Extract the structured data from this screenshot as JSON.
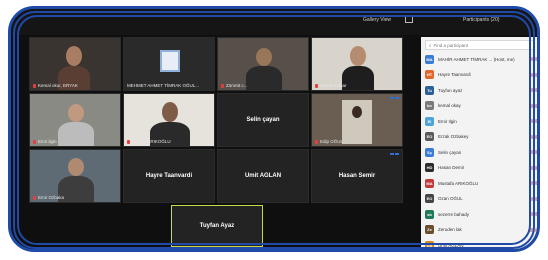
{
  "window": {
    "view_label": "Gallery View",
    "meeting_title": "Participants (20)"
  },
  "tiles": [
    {
      "name": "Kemal okur, ERYAK",
      "type": "video"
    },
    {
      "name": "MEHMET AHMET TİMRAK OĞUL...",
      "type": "logo"
    },
    {
      "name": "Zümrüt c...",
      "type": "video"
    },
    {
      "name": "sepere bahar",
      "type": "video"
    },
    {
      "name": "Emir ilgin",
      "type": "video"
    },
    {
      "name": "SATAN ARIKOĞLU",
      "type": "video"
    },
    {
      "name": "Selin çayan",
      "type": "name"
    },
    {
      "name": "Edip OĞUL",
      "type": "video"
    },
    {
      "name": "Emir Ozbaka",
      "type": "video"
    },
    {
      "name": "Hayre Taanvardi",
      "type": "name"
    },
    {
      "name": "Umit AGLAN",
      "type": "name"
    },
    {
      "name": "Hasan Semir",
      "type": "name"
    },
    {
      "name": "Tuyfan Ayaz",
      "type": "name"
    }
  ],
  "panel": {
    "search_placeholder": "Find a participant",
    "participants": [
      {
        "initials": "MA",
        "name": "MAHİR AHMET TİMRAK ... (Host, me)",
        "color": "#3a7bd5"
      },
      {
        "initials": "HT",
        "name": "Hayre Taanvardi",
        "color": "#e0682a"
      },
      {
        "initials": "Tu",
        "name": "Tuyfun ayaz",
        "color": "#2d5f9a"
      },
      {
        "initials": "ko",
        "name": "kemal okay",
        "color": "#7a7a7a"
      },
      {
        "initials": "Ei",
        "name": "Emir Ilgin",
        "color": "#4ea3d8"
      },
      {
        "initials": "EO",
        "name": "Erzak Ozbakey",
        "color": "#5a5a5a"
      },
      {
        "initials": "Sç",
        "name": "Selin çayan",
        "color": "#3a7bd5"
      },
      {
        "initials": "HD",
        "name": "Hasan Demir",
        "color": "#2b2b2b"
      },
      {
        "initials": "MA",
        "name": "Mustafa ARIKOĞLU",
        "color": "#c23b3b"
      },
      {
        "initials": "EO",
        "name": "Ozan OĞUL",
        "color": "#444444"
      },
      {
        "initials": "sb",
        "name": "sezerre bahady",
        "color": "#1f7a56"
      },
      {
        "initials": "Ze",
        "name": "Zeruden lak",
        "color": "#6b4e2e"
      },
      {
        "initials": "UA",
        "name": "Umit AGLAN",
        "color": "#d98a1c"
      }
    ]
  },
  "colors": {
    "frame": "#1f4aa8",
    "meeting_bg": "#0f0f0f",
    "tile_bg": "#232323",
    "active_border": "#c8d84a",
    "panel_bg": "#f3f3f3"
  }
}
